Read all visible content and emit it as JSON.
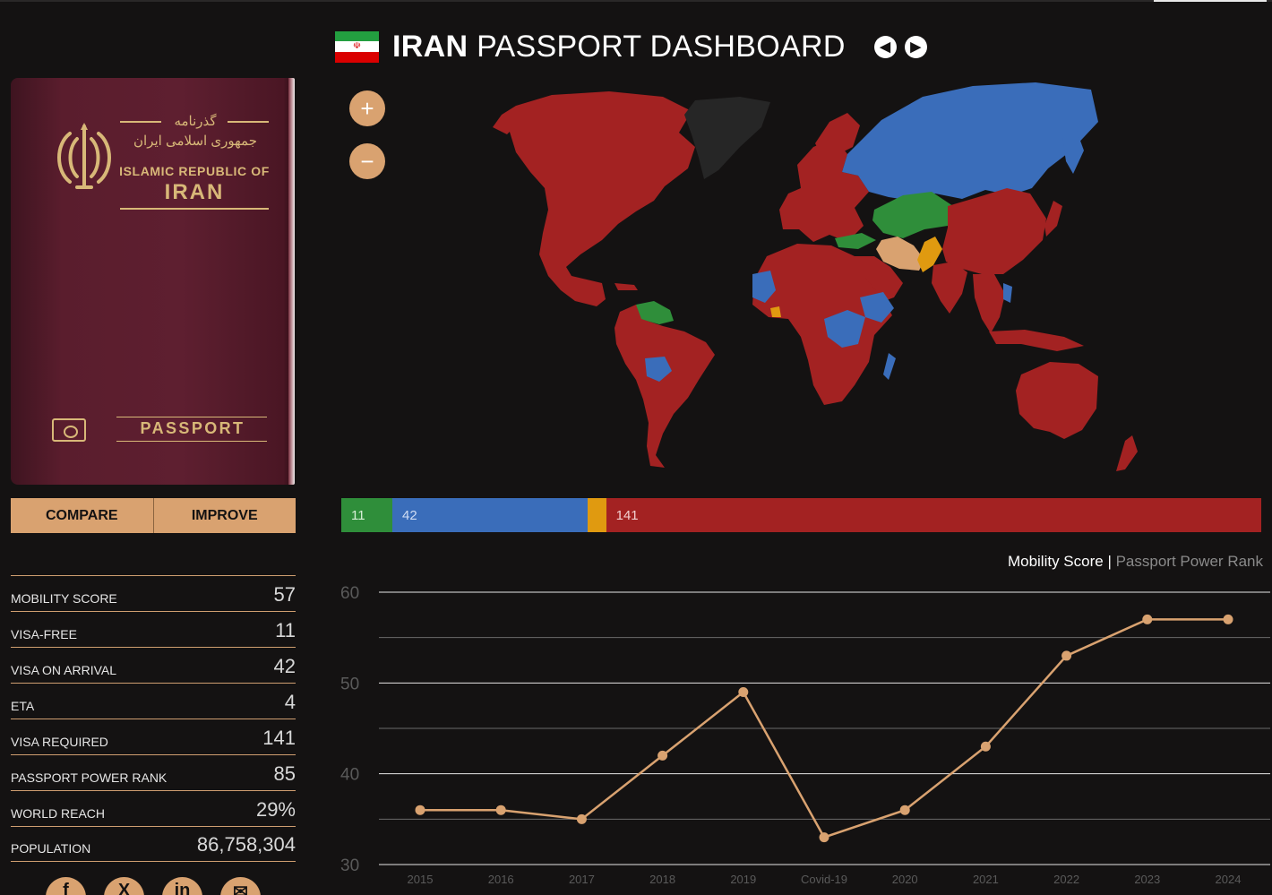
{
  "header": {
    "country": "IRAN",
    "title_rest": "PASSPORT DASHBOARD",
    "flag_emblem": "☫",
    "prev_icon": "◀",
    "next_icon": "▶"
  },
  "passport": {
    "persian_line1": "گذرنامه",
    "persian_line2": "جمهوری اسلامی ایران",
    "republic": "ISLAMIC REPUBLIC OF",
    "country": "IRAN",
    "word": "PASSPORT"
  },
  "actions": {
    "compare": "COMPARE",
    "improve": "IMPROVE"
  },
  "stats": [
    {
      "label": "MOBILITY SCORE",
      "value": "57"
    },
    {
      "label": "VISA-FREE",
      "value": "11"
    },
    {
      "label": "VISA ON ARRIVAL",
      "value": "42"
    },
    {
      "label": "ETA",
      "value": "4"
    },
    {
      "label": "VISA REQUIRED",
      "value": "141"
    },
    {
      "label": "PASSPORT POWER RANK",
      "value": "85"
    },
    {
      "label": "WORLD REACH",
      "value": "29%"
    },
    {
      "label": "POPULATION",
      "value": "86,758,304"
    }
  ],
  "social": [
    {
      "name": "facebook-icon",
      "glyph": "f"
    },
    {
      "name": "x-icon",
      "glyph": "X"
    },
    {
      "name": "linkedin-icon",
      "glyph": "in"
    },
    {
      "name": "email-icon",
      "glyph": "✉"
    }
  ],
  "map": {
    "zoom_in": "+",
    "zoom_out": "−",
    "legend_colors": {
      "visa_free": "#2f8e3a",
      "visa_on_arrival": "#3a6dba",
      "eta": "#e09a10",
      "visa_required": "#a32222",
      "home": "#d9a270",
      "unknown": "#2a2a2a"
    }
  },
  "distribution": {
    "visa_free": 11,
    "visa_on_arrival": 42,
    "eta": 4,
    "visa_required": 141,
    "labels": {
      "visa_free": "11",
      "visa_on_arrival": "42",
      "eta": "",
      "visa_required": "141"
    }
  },
  "chart_header": {
    "active": "Mobility Score",
    "separator": " | ",
    "inactive": "Passport Power Rank"
  },
  "chart_data": {
    "type": "line",
    "categories": [
      "2015",
      "2016",
      "2017",
      "2018",
      "2019",
      "Covid-19",
      "2020",
      "2021",
      "2022",
      "2023",
      "2024"
    ],
    "values": [
      36,
      36,
      35,
      42,
      49,
      33,
      36,
      43,
      53,
      57,
      57
    ],
    "ylim": [
      30,
      60
    ],
    "yticks": [
      30,
      40,
      50,
      60
    ],
    "color": "#d9a270",
    "grid": true
  }
}
